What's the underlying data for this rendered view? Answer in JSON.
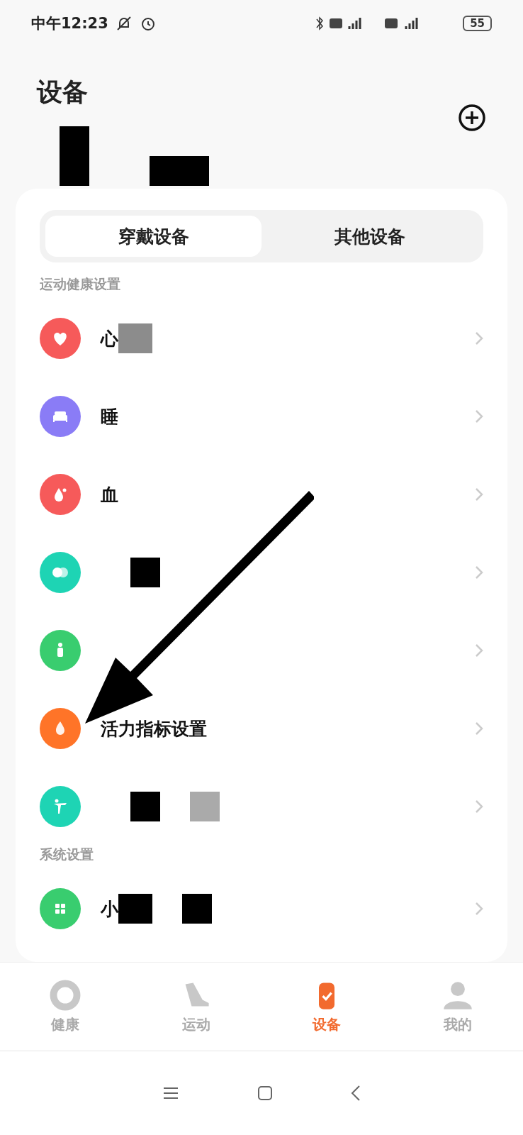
{
  "status_bar": {
    "time": "中午12:23",
    "battery": "55"
  },
  "header": {
    "title": "设备",
    "masks": [
      {
        "color": "#000000"
      },
      {
        "color": "#000000"
      }
    ]
  },
  "tabs": [
    {
      "label": "穿戴设备",
      "selected": true
    },
    {
      "label": "其他设备",
      "selected": false
    }
  ],
  "sections": [
    {
      "title": "运动健康设置",
      "items": [
        {
          "color": "#f65a5a",
          "label": "心",
          "masks": [
            {
              "color": "#8c8c8c"
            }
          ]
        },
        {
          "color": "#8a7cf6",
          "label": "睡"
        },
        {
          "color": "#f65a5a",
          "label": "血"
        },
        {
          "color": "#1ed4b4",
          "masks": [
            {
              "color": "#000000"
            }
          ]
        },
        {
          "color": "#39cd6f"
        },
        {
          "color": "#ff7428",
          "label": "活力指标设置"
        },
        {
          "color": "#1ed4b4",
          "masks": [
            {
              "color": "#000000"
            },
            {
              "color": "#aaaaaa"
            }
          ]
        }
      ]
    },
    {
      "title": "系统设置",
      "items": [
        {
          "color": "#39cd6f",
          "label": "小",
          "masks": [
            {
              "color": "#000000"
            },
            {
              "color": "#000000"
            }
          ]
        }
      ]
    }
  ],
  "bottom_nav": [
    {
      "label": "健康",
      "selected": false
    },
    {
      "label": "运动",
      "selected": false
    },
    {
      "label": "设备",
      "selected": true
    },
    {
      "label": "我的",
      "selected": false
    }
  ]
}
